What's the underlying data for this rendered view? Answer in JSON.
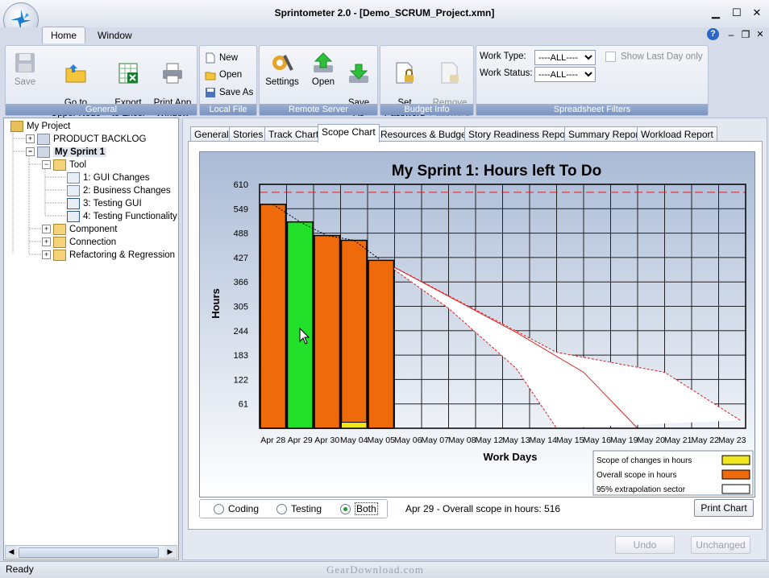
{
  "window": {
    "title": "Sprintometer 2.0 - [Demo_SCRUM_Project.xmn]",
    "minimize": "▁",
    "maximize": "☐",
    "close": "✕",
    "help": "?",
    "child_min": "–",
    "child_restore": "❐",
    "child_close": "✕"
  },
  "menu_tabs": [
    "Home",
    "Window"
  ],
  "ribbon": {
    "general": {
      "label": "General",
      "save": "Save",
      "upper_node": "Go to\nUpper Node",
      "export_excel": "Export\nto Excel",
      "print_app": "Print App\nWindow"
    },
    "local_file": {
      "label": "Local File",
      "new": "New",
      "open": "Open",
      "save_as": "Save As"
    },
    "remote_server": {
      "label": "Remote Server",
      "settings": "Settings",
      "open": "Open",
      "save_as": "Save\nAs"
    },
    "budget_info": {
      "label": "Budget Info",
      "set_password": "Set\nPassword",
      "remove_password": "Remove\nPassword"
    },
    "filters": {
      "label": "Spreadsheet Filters",
      "work_type_label": "Work Type:",
      "work_type_value": "----ALL----",
      "work_status_label": "Work Status:",
      "work_status_value": "----ALL----",
      "show_last_day": "Show Last Day only"
    }
  },
  "tree": {
    "root": "My Project",
    "backlog": "PRODUCT BACKLOG",
    "sprint": "My Sprint 1",
    "tool": "Tool",
    "items": [
      "1: GUI Changes",
      "2: Business Changes",
      "3: Testing GUI",
      "4: Testing Functionality"
    ],
    "component": "Component",
    "connection": "Connection",
    "refactoring": "Refactoring & Regression"
  },
  "tabs": [
    "General",
    "Stories",
    "Track Chart",
    "Scope Chart",
    "Resources & Budget",
    "Story Readiness Report",
    "Summary Report",
    "Workload Report"
  ],
  "active_tab": "Scope Chart",
  "chart_data": {
    "type": "bar",
    "title": "My Sprint 1: Hours left To Do",
    "xlabel": "Work Days",
    "ylabel": "Hours",
    "ylim": [
      0,
      610
    ],
    "yticks": [
      61,
      122,
      183,
      244,
      305,
      366,
      427,
      488,
      549,
      610
    ],
    "categories": [
      "Apr 28",
      "Apr 29",
      "Apr 30",
      "May 04",
      "May 05",
      "May 06",
      "May 07",
      "May 08",
      "May 12",
      "May 13",
      "May 14",
      "May 15",
      "May 16",
      "May 19",
      "May 20",
      "May 21",
      "May 22",
      "May 23"
    ],
    "series": [
      {
        "name": "Overall scope in hours",
        "values": [
          560,
          516,
          482,
          470,
          420
        ]
      },
      {
        "name": "Scope of changes in hours",
        "values": [
          0,
          0,
          0,
          15,
          0
        ]
      }
    ],
    "highlighted_category": "Apr 29",
    "initial_scope_line": 590,
    "extrapolation": {
      "start_index": 4.5,
      "start_value": 420,
      "upper": [
        [
          4.5,
          420
        ],
        [
          17.8,
          20
        ]
      ],
      "upper_bend": [
        [
          4.5,
          420
        ],
        [
          11.0,
          190
        ],
        [
          15.0,
          140
        ],
        [
          17.8,
          20
        ]
      ],
      "middle": [
        [
          4.5,
          420
        ],
        [
          7.0,
          330
        ],
        [
          9.5,
          240
        ],
        [
          12.0,
          140
        ],
        [
          14.0,
          0
        ]
      ],
      "lower": [
        [
          4.5,
          420
        ],
        [
          7.0,
          300
        ],
        [
          9.5,
          150
        ],
        [
          11.0,
          0
        ]
      ]
    },
    "colors": {
      "scope": "#ee6a0a",
      "highlight": "#22e02a",
      "changes": "#f0e61e",
      "sector": "#ffffff",
      "limit": "#e02020"
    },
    "legend": {
      "position": "bottom-right",
      "items": [
        "Scope of changes in hours",
        "Overall scope in hours",
        "95% extrapolation sector"
      ]
    }
  },
  "view_options": {
    "coding": "Coding",
    "testing": "Testing",
    "both": "Both",
    "selected": "Both"
  },
  "info_text": "Apr 29 - Overall scope in hours: 516",
  "print_chart": "Print Chart",
  "undo": "Undo",
  "unchanged": "Unchanged",
  "status": "Ready",
  "watermark": "GearDownload.com"
}
